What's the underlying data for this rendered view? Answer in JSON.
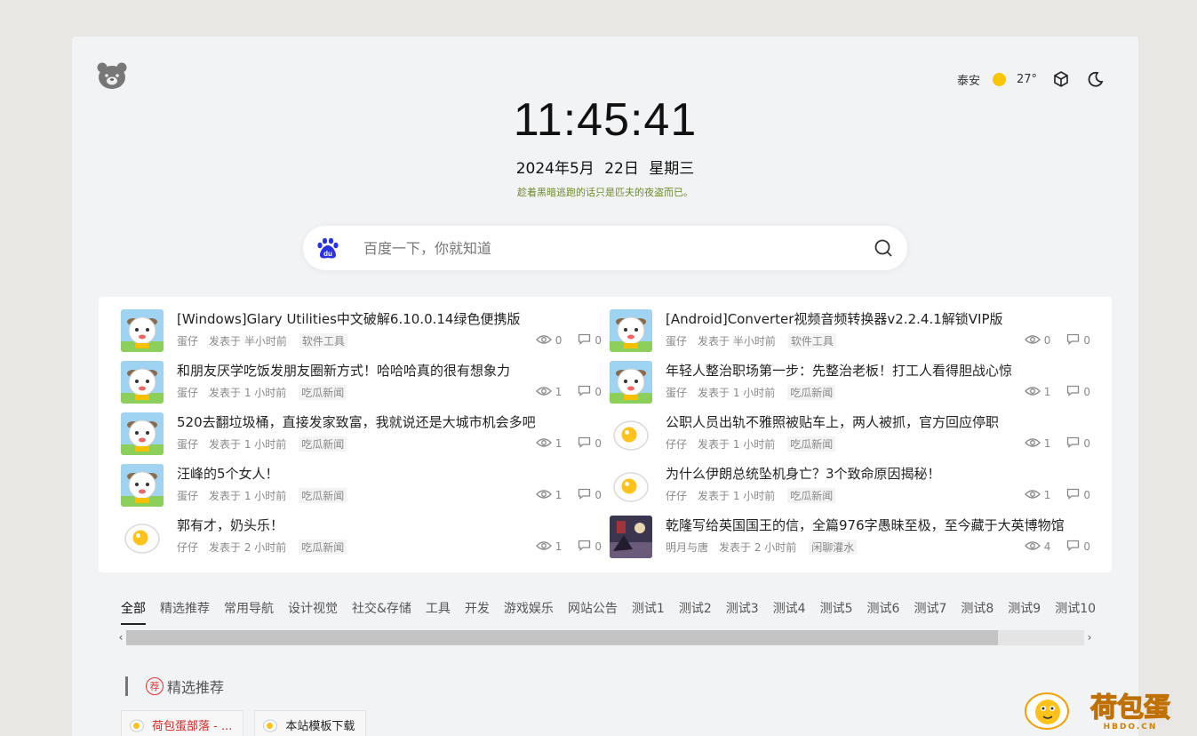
{
  "weather": {
    "city": "泰安",
    "temp": "27°"
  },
  "clock": {
    "time": "11:45:41"
  },
  "date": {
    "ymd": "2024年5月",
    "day": "22日",
    "weekday": "星期三"
  },
  "motto": "趁着黑暗逃跑的话只是匹夫的夜盗而已。",
  "search": {
    "placeholder": "百度一下，你就知道"
  },
  "news": {
    "items": [
      {
        "title": "[Windows]Glary Utilities中文破解6.10.0.14绿色便携版",
        "author": "蛋仔",
        "time": "发表于 半小时前",
        "category": "软件工具",
        "views": "0",
        "comments": "0",
        "avatar": "sheep"
      },
      {
        "title": "[Android]Converter视频音频转换器v2.2.4.1解锁VIP版",
        "author": "蛋仔",
        "time": "发表于 半小时前",
        "category": "软件工具",
        "views": "0",
        "comments": "0",
        "avatar": "sheep"
      },
      {
        "title": "和朋友厌学吃饭发朋友圈新方式！哈哈哈真的很有想象力",
        "author": "蛋仔",
        "time": "发表于 1 小时前",
        "category": "吃瓜新闻",
        "views": "1",
        "comments": "0",
        "avatar": "sheep"
      },
      {
        "title": "年轻人整治职场第一步：先整治老板！打工人看得胆战心惊",
        "author": "蛋仔",
        "time": "发表于 1 小时前",
        "category": "吃瓜新闻",
        "views": "1",
        "comments": "0",
        "avatar": "sheep"
      },
      {
        "title": "520去翻垃圾桶，直接发家致富，我就说还是大城市机会多吧",
        "author": "蛋仔",
        "time": "发表于 1 小时前",
        "category": "吃瓜新闻",
        "views": "1",
        "comments": "0",
        "avatar": "sheep"
      },
      {
        "title": "公职人员出轨不雅照被贴车上，两人被抓，官方回应停职",
        "author": "仔仔",
        "time": "发表于 1 小时前",
        "category": "吃瓜新闻",
        "views": "1",
        "comments": "0",
        "avatar": "egg"
      },
      {
        "title": "汪峰的5个女人！",
        "author": "蛋仔",
        "time": "发表于 1 小时前",
        "category": "吃瓜新闻",
        "views": "1",
        "comments": "0",
        "avatar": "sheep"
      },
      {
        "title": "为什么伊朗总统坠机身亡？3个致命原因揭秘！",
        "author": "仔仔",
        "time": "发表于 1 小时前",
        "category": "吃瓜新闻",
        "views": "1",
        "comments": "0",
        "avatar": "egg"
      },
      {
        "title": "郭有才，奶头乐！",
        "author": "仔仔",
        "time": "发表于 2 小时前",
        "category": "吃瓜新闻",
        "views": "1",
        "comments": "0",
        "avatar": "egg"
      },
      {
        "title": "乾隆写给英国国王的信，全篇976字愚昧至极，至今藏于大英博物馆",
        "author": "明月与唐",
        "time": "发表于 2 小时前",
        "category": "闲聊灌水",
        "views": "4",
        "comments": "0",
        "avatar": "painting"
      }
    ]
  },
  "tabs": [
    "全部",
    "精选推荐",
    "常用导航",
    "设计视觉",
    "社交&存储",
    "工具",
    "开发",
    "游戏娱乐",
    "网站公告",
    "测试1",
    "测试2",
    "测试3",
    "测试4",
    "测试5",
    "测试6",
    "测试7",
    "测试8",
    "测试9",
    "测试10"
  ],
  "section": {
    "badge": "荐",
    "title": "精选推荐"
  },
  "links": [
    {
      "label": "荷包蛋部落 - ...",
      "style": "red"
    },
    {
      "label": "本站模板下载",
      "style": "normal"
    }
  ],
  "brand": {
    "name": "荷包蛋",
    "domain": "HBDO.CN"
  },
  "colors": {
    "accent": "#f7c600",
    "motto": "#6f8a2c",
    "background": "#e9e7e3"
  }
}
